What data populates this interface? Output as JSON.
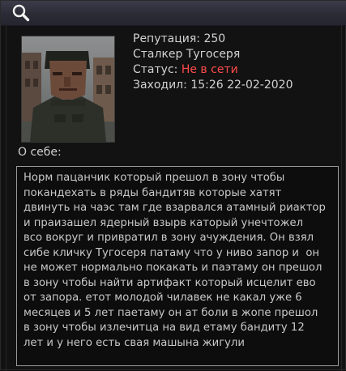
{
  "toolbar": {
    "search_icon": "search-icon"
  },
  "profile": {
    "reputation_label": "Репутация: ",
    "reputation_value": "250",
    "name": "Сталкер Тугосеря",
    "status_label": "Статус: ",
    "status_value": "Не в сети",
    "last_seen_label": "Заходил: ",
    "last_seen_value": "15:26 22-02-2020"
  },
  "about": {
    "label": "О себе:",
    "text": "Норм пацанчик который прешол в зону чтобы\nпокандехать в ряды бандитяв которые хатят\nдвинуть на чаэс там где взарвался атамный риактор\nи праизашел ядерный взырв каторый унечтожел\nвсо вокруг и привратил в зону ачуждения. Он взял\nсибе кличку Тугосеря патаму что у ниво запор и  он\nне может нормально покакать и паэтаму он прешол\nв зону чтобы найти артифакт который исцелит ево\nот запора. етот молодой чилавек не какал уже 6\nмесяцев и 5 лет паетаму он ат боли в жопе прешол\nв зону чтобы излечитца на вид етаму бандиту 12\nлет и у него есть свая машына жигули"
  },
  "colors": {
    "status_offline": "#ff4a4a",
    "titlebar": "#33333f"
  }
}
